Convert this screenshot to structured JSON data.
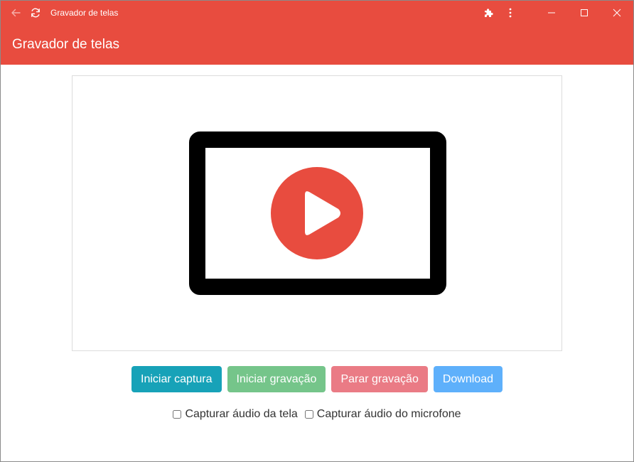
{
  "window": {
    "title": "Gravador de telas"
  },
  "header": {
    "title": "Gravador de telas"
  },
  "buttons": {
    "capture": "Iniciar captura",
    "start_recording": "Iniciar gravação",
    "stop_recording": "Parar gravação",
    "download": "Download"
  },
  "options": {
    "screen_audio": {
      "label": "Capturar áudio da tela",
      "checked": false
    },
    "mic_audio": {
      "label": "Capturar áudio do microfone",
      "checked": false
    }
  },
  "icons": {
    "back": "arrow-left-icon",
    "refresh": "refresh-icon",
    "extensions": "puzzle-icon",
    "menu": "kebab-menu-icon",
    "minimize": "minimize-icon",
    "maximize": "maximize-icon",
    "close": "close-icon",
    "preview": "video-play-icon"
  },
  "colors": {
    "brand": "#e84c3f",
    "capture_button": "#17a2b8",
    "start_button": "#75c58a",
    "stop_button": "#ea7b85",
    "download_button": "#5eb0fb"
  }
}
